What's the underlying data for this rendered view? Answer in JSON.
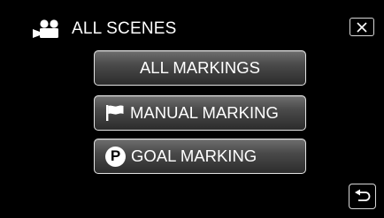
{
  "header": {
    "icon": "movie-camera-icon",
    "title": "ALL SCENES"
  },
  "close_button": {
    "icon": "close-icon"
  },
  "menu": {
    "items": [
      {
        "label": "ALL MARKINGS",
        "icon": ""
      },
      {
        "label": "MANUAL MARKING",
        "icon": "flag-icon"
      },
      {
        "label": "GOAL MARKING",
        "icon": "goal-p-icon",
        "icon_text": "P"
      }
    ]
  },
  "back_button": {
    "icon": "return-arrow-icon"
  },
  "colors": {
    "background": "#000000",
    "button_top": "#6e6e6e",
    "button_bottom": "#2c2c2c",
    "border": "#e4e4e4",
    "text": "#ffffff"
  }
}
